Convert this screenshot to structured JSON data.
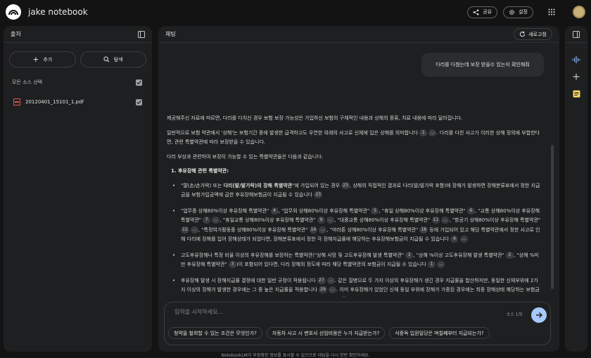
{
  "app": {
    "title": "jake notebook"
  },
  "header": {
    "share_label": "공유",
    "settings_label": "설정"
  },
  "sources": {
    "title": "출처",
    "add_label": "추가",
    "discover_label": "탐색",
    "select_all_label": "모든 소스 선택",
    "select_all_checked": true,
    "files": [
      {
        "name": "20120401_15101_1.pdf",
        "checked": true
      }
    ]
  },
  "chat": {
    "title": "채팅",
    "refresh_label": "새로고침",
    "user_message": "다리를 다쳤는데 보장 받을수 있는지 확인해줘",
    "answer": {
      "p1": "제공해주신 자료에 따르면, 다리를 다치신 경우 보험 보장 가능성은 가입하신 보험의 구체적인 내용과 상해의 종류, 치료 내용에 따라 달라집니다.",
      "p2": "일반적으로 보험 약관에서 '상해'는 보험기간 중에 발생한 급격하고도 우연한 외래의 사고로 신체에 입은 상해를 의미합니다",
      "p2_cite1": "1",
      "p2_cite2": "...",
      "p2_tail": ". 다리를 다친 사고가 이러한 상해 정의에 부합한다면, 관련 특별약관에 따라 보장받을 수 있습니다.",
      "p3": "다리 부상과 관련하여 보장이 가능할 수 있는 특별약관들은 다음과 같습니다:",
      "h1": "1. 후유장해 관련 특별약관:",
      "b1_a": "\"팔(손/손가락) 또는",
      "b1_bold": "다리(발/발가락)의 장해 특별약관",
      "b1_b": "\"에 가입되어 있는 경우",
      "b1_c1": "23",
      "b1_c2": ", 상해의 직접적인 결과로 다리(발/발가락 포함)에 장해가 발생하면 장해분류표에서 정한 지급금을 보험가입금액에 곱한 후유장해보험금이 지급될 수 있습니다",
      "b1_c3": "23",
      "b2_1": "\"업무중 상해80%이상 후유장해 특별약관\"",
      "b2_c1": "4",
      "b2_2": ", \"업무외 상해80%이상 후유장해 특별약관\"",
      "b2_c2": "5",
      "b2_3": ", \"휴일 상해80%이상 후유장해 특별약관\"",
      "b2_c3": "6",
      "b2_4": ", \"교통 상해80%이상 후유장해 특별약관\"",
      "b2_c4": "7",
      "b2_c5": "...",
      "b2_5": ", \"휴일교통 상해80%이상 후유장해 특별약관\"",
      "b2_c6": "9",
      "b2_c7": "...",
      "b2_6": ", \"대중교통 상해80%이상 후유장해 특별약관\"",
      "b2_c8": "11",
      "b2_c9": "...",
      "b2_7": ", \"항공기 상해80%이상 후유장해 특별약관\"",
      "b2_c10": "12",
      "b2_c11": "...",
      "b2_8": ", \"특정여가활동중 상해80%이상 후유장해 특별약관\"",
      "b2_c12": "14",
      "b2_c13": "...",
      "b2_9": ", \"마라톤 상해80%이상 후유장해 특별약관\"",
      "b2_c14": "18",
      "b2_10": " 등에 가입되어 있고 해당 특별약관에서 정한 사고로 인해 다리에 장해를 입어 장해상태가 되었다면, 장해분류표에서 정한 각 장해지급률에 해당하는 후유장해보험금이 지급될 수 있습니다",
      "b2_c15": "4",
      "b2_c16": "...",
      "b3_1": "고도후유장해나 특정 비율 이상의 후유장해를 보장하는 특별약관(\"상해 사망 및 고도후유장해 발생 특별약관\"",
      "b3_c1": "2",
      "b3_2": ", \"상해 %이상 고도후유장해 발생 특별약관\"",
      "b3_c2": "2",
      "b3_3": ", \"상해 %미만 후유장해 특별약관\"",
      "b3_c3": "3",
      "b3_4": ")이 포함되어 있다면, 다리 장해의 정도에 따라 해당 특별약관의 보험금이 지급될 수 있습니다",
      "b3_c4": "1",
      "b3_c5": "...",
      "b4_1": "후유장해 발생 시 장해지급률 결정에 대한 일반 규정이 적용됩니다",
      "b4_c1": "27",
      "b4_c2": "...",
      "b4_2": ". 같은 질병으로 두 가지 이상의 후유장해가 생긴 경우 지급률을 합산하지만, 동일한 신체부위에 2가지 이상의 장해가 발생한 경우에는 그 중 높은 지급률을 적용합니다",
      "b4_c3": "29",
      "b4_c4": "...",
      "b4_3": ". 이미 후유장해가 있었던 신체 동일 부위에 장해가 가중된 경우에는 최종 장해상태 해당하는 보험금에서 이미 지급받았거나 지급받은 것으로 간주한 금액을 차감하여 지급합니다",
      "b4_c5": "28"
    },
    "input": {
      "placeholder": "입력을 시작하세요...",
      "source_count": "소스 1개"
    },
    "suggestions": [
      "청약을 철회할 수 있는 조건은 무엇인가?",
      "자동차 사고 시 변호사 선임비용은 누가 지급받는가?",
      "식중독 입원일당은 며칠째부터 지급되는가?"
    ]
  },
  "footer": {
    "disclaimer": "NotebookLM가 부정확한 정보를 표시할 수 있으므로 대답을 다시 한번 확인하세요."
  },
  "colors": {
    "accent": "#a8c7fa",
    "studio_audio": "#8ab4f8",
    "studio_note": "#fdd663",
    "pdf": "#e05a4f"
  }
}
